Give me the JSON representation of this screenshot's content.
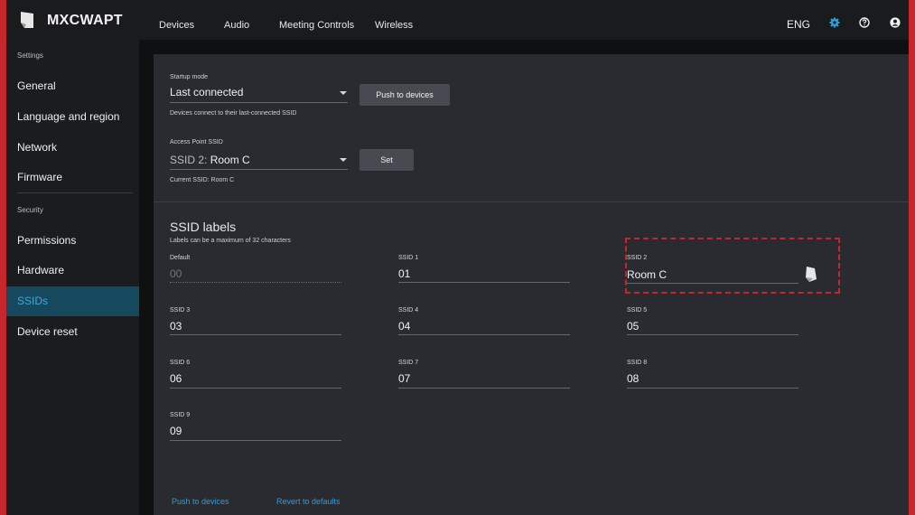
{
  "app": {
    "title": "MXCWAPT"
  },
  "nav": [
    "Devices",
    "Audio",
    "Meeting Controls",
    "Wireless"
  ],
  "topright": {
    "language": "ENG"
  },
  "sidebar": {
    "settings_header": "Settings",
    "security_header": "Security",
    "items": [
      "General",
      "Language and region",
      "Network",
      "Firmware"
    ],
    "security_items": [
      "Permissions",
      "Hardware",
      "SSIDs",
      "Device reset"
    ],
    "active": "SSIDs"
  },
  "startup": {
    "label": "Startup mode",
    "value": "Last connected",
    "button": "Push to devices",
    "help": "Devices connect to their last-connected SSID"
  },
  "ap": {
    "label": "Access Point SSID",
    "value_prefix": "SSID 2:",
    "value": "Room C",
    "button": "Set",
    "current": "Current SSID: Room C"
  },
  "ssid_labels": {
    "title": "SSID labels",
    "help": "Labels can be a maximum of 32 characters",
    "fields": [
      {
        "label": "Default",
        "value": "00"
      },
      {
        "label": "SSID 1",
        "value": "01"
      },
      {
        "label": "SSID 2",
        "value": "Room C"
      },
      {
        "label": "SSID 3",
        "value": "03"
      },
      {
        "label": "SSID 4",
        "value": "04"
      },
      {
        "label": "SSID 5",
        "value": "05"
      },
      {
        "label": "SSID 6",
        "value": "06"
      },
      {
        "label": "SSID 7",
        "value": "07"
      },
      {
        "label": "SSID 8",
        "value": "08"
      },
      {
        "label": "SSID 9",
        "value": "09"
      }
    ]
  },
  "footer": {
    "push": "Push to devices",
    "revert": "Revert to defaults"
  },
  "colors": {
    "accent": "#2e9ed8",
    "active_bg": "#17495e",
    "highlight": "#c6262c"
  }
}
